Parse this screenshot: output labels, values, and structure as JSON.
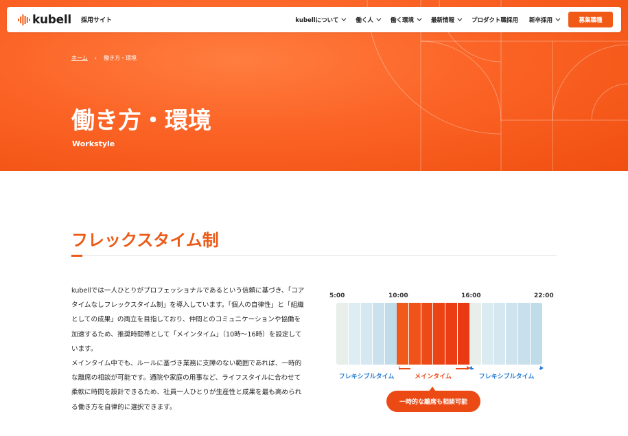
{
  "header": {
    "logo_text": "kubell",
    "site_label": "採用サイト",
    "nav": [
      {
        "label": "kubellについて"
      },
      {
        "label": "働く人"
      },
      {
        "label": "働く環境"
      },
      {
        "label": "最新情報"
      },
      {
        "label": "プロダクト職採用"
      },
      {
        "label": "新卒採用"
      }
    ],
    "cta_label": "募集職種"
  },
  "breadcrumb": {
    "home": "ホーム",
    "separator": "›",
    "current": "働き方・環境"
  },
  "hero": {
    "title": "働き方・環境",
    "subtitle": "Workstyle"
  },
  "section": {
    "title": "フレックスタイム制",
    "paragraphs": [
      "kubellでは一人ひとりがプロフェッショナルであるという信頼に基づき、「コアタイムなしフレックスタイム制」を導入しています。「個人の自律性」と「組織としての成果」の両立を目指しており、仲間とのコミュニケーションや協働を加速するため、推奨時間帯として「メインタイム」（10時〜16時）を設定しています。",
      "メインタイム中でも、ルールに基づき業務に支障のない範囲であれば、一時的な離席の相談が可能です。通院や家庭の用事など、ライフスタイルに合わせて柔軟に時間を設計できるため、社員一人ひとりが生産性と成果を最も高められる働き方を自律的に選択できます。"
    ]
  },
  "timeline": {
    "ticks": [
      "5:00",
      "10:00",
      "16:00",
      "22:00"
    ],
    "labels": {
      "flex_left": "フレキシブルタイム",
      "main": "メインタイム",
      "flex_right": "フレキシブルタイム"
    },
    "note": "一時的な離席も相談可能",
    "colors": {
      "flex": "#dce8ef",
      "main": "#ee4c16",
      "accent": "#ec5a17",
      "blue": "#2a7ed4"
    }
  }
}
